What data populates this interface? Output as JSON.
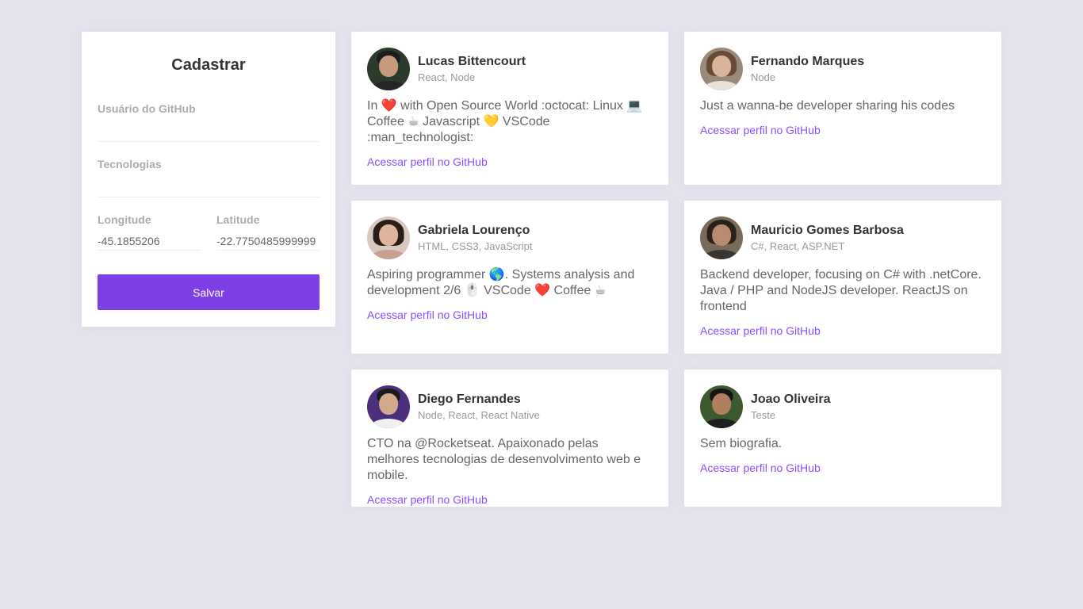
{
  "form": {
    "title": "Cadastrar",
    "github_user": {
      "label": "Usuário do GitHub",
      "value": ""
    },
    "techs": {
      "label": "Tecnologias",
      "value": ""
    },
    "longitude": {
      "label": "Longitude",
      "value": "-45.1855206"
    },
    "latitude": {
      "label": "Latitude",
      "value": "-22.7750485999999"
    },
    "save_label": "Salvar"
  },
  "colors": {
    "accent": "#7d40e7",
    "link": "#8e4dff",
    "background": "#e4e4ee"
  },
  "devs": [
    {
      "name": "Lucas Bittencourt",
      "techs": "React, Node",
      "bio": "In ❤️ with Open Source World :octocat: Linux 💻 Coffee ☕ Javascript 💛 VSCode :man_technologist:",
      "link": "Acessar perfil no GitHub",
      "avatar": "avatar-photo"
    },
    {
      "name": "Fernando Marques",
      "techs": "Node",
      "bio": "Just a wanna-be developer sharing his codes",
      "link": "Acessar perfil no GitHub",
      "avatar": "avatar-photo"
    },
    {
      "name": "Gabriela Lourenço",
      "techs": "HTML, CSS3, JavaScript",
      "bio": "Aspiring programmer 🌎. Systems analysis and development 2/6 🖱️ VSCode ❤️ Coffee ☕",
      "link": "Acessar perfil no GitHub",
      "avatar": "avatar-photo"
    },
    {
      "name": "Mauricio Gomes Barbosa",
      "techs": "C#, React, ASP.NET",
      "bio": "Backend developer, focusing on C# with .netCore. Java / PHP and NodeJS developer. ReactJS on frontend",
      "link": "Acessar perfil no GitHub",
      "avatar": "avatar-photo"
    },
    {
      "name": "Diego Fernandes",
      "techs": "Node, React, React Native",
      "bio": "CTO na @Rocketseat. Apaixonado pelas melhores tecnologias de desenvolvimento web e mobile.",
      "link": "Acessar perfil no GitHub",
      "avatar": "avatar-photo"
    },
    {
      "name": "Joao Oliveira",
      "techs": "Teste",
      "bio": "Sem biografia.",
      "link": "Acessar perfil no GitHub",
      "avatar": "avatar-photo"
    }
  ]
}
